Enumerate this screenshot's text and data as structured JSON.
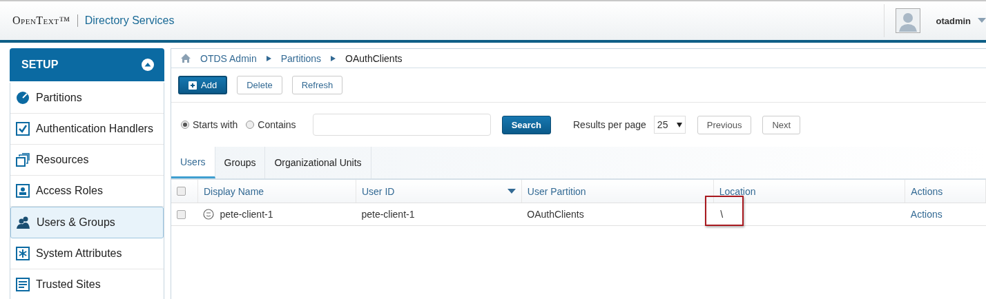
{
  "header": {
    "brand": "OpenText™",
    "product": "Directory Services",
    "user": "otadmin"
  },
  "sidebar": {
    "title": "SETUP",
    "items": [
      {
        "label": "Partitions",
        "kind": "disc",
        "selected": false
      },
      {
        "label": "Authentication Handlers",
        "kind": "check",
        "selected": false
      },
      {
        "label": "Resources",
        "kind": "stack",
        "selected": false
      },
      {
        "label": "Access Roles",
        "kind": "badge",
        "selected": false
      },
      {
        "label": "Users & Groups",
        "kind": "people",
        "selected": true
      },
      {
        "label": "System Attributes",
        "kind": "asterisk",
        "selected": false
      },
      {
        "label": "Trusted Sites",
        "kind": "list",
        "selected": false
      }
    ]
  },
  "breadcrumb": [
    "OTDS Admin",
    "Partitions",
    "OAuthClients"
  ],
  "toolbar": [
    {
      "label": "Add",
      "kind": "primary"
    },
    {
      "label": "Delete",
      "kind": "plain"
    },
    {
      "label": "Refresh",
      "kind": "plain"
    }
  ],
  "search": {
    "modes": [
      {
        "label": "Starts with",
        "selected": true
      },
      {
        "label": "Contains",
        "selected": false
      }
    ],
    "button": "Search",
    "results_label": "Results per page",
    "results_value": "25",
    "previous": "Previous",
    "next": "Next"
  },
  "tabs": [
    {
      "label": "Users",
      "selected": true
    },
    {
      "label": "Groups",
      "selected": false
    },
    {
      "label": "Organizational Units",
      "selected": false
    }
  ],
  "table": {
    "header_checked": false,
    "columns": [
      {
        "label": "Display Name",
        "sorted": false
      },
      {
        "label": "User ID",
        "sorted": true
      },
      {
        "label": "User Partition",
        "sorted": false
      },
      {
        "label": "Location",
        "sorted": false
      },
      {
        "label": "Actions",
        "sorted": false
      }
    ],
    "rows": [
      {
        "checked": false,
        "display_name": "pete-client-1",
        "user_id": "pete-client-1",
        "partition": "OAuthClients",
        "location": "\\",
        "actions": "Actions"
      }
    ]
  }
}
